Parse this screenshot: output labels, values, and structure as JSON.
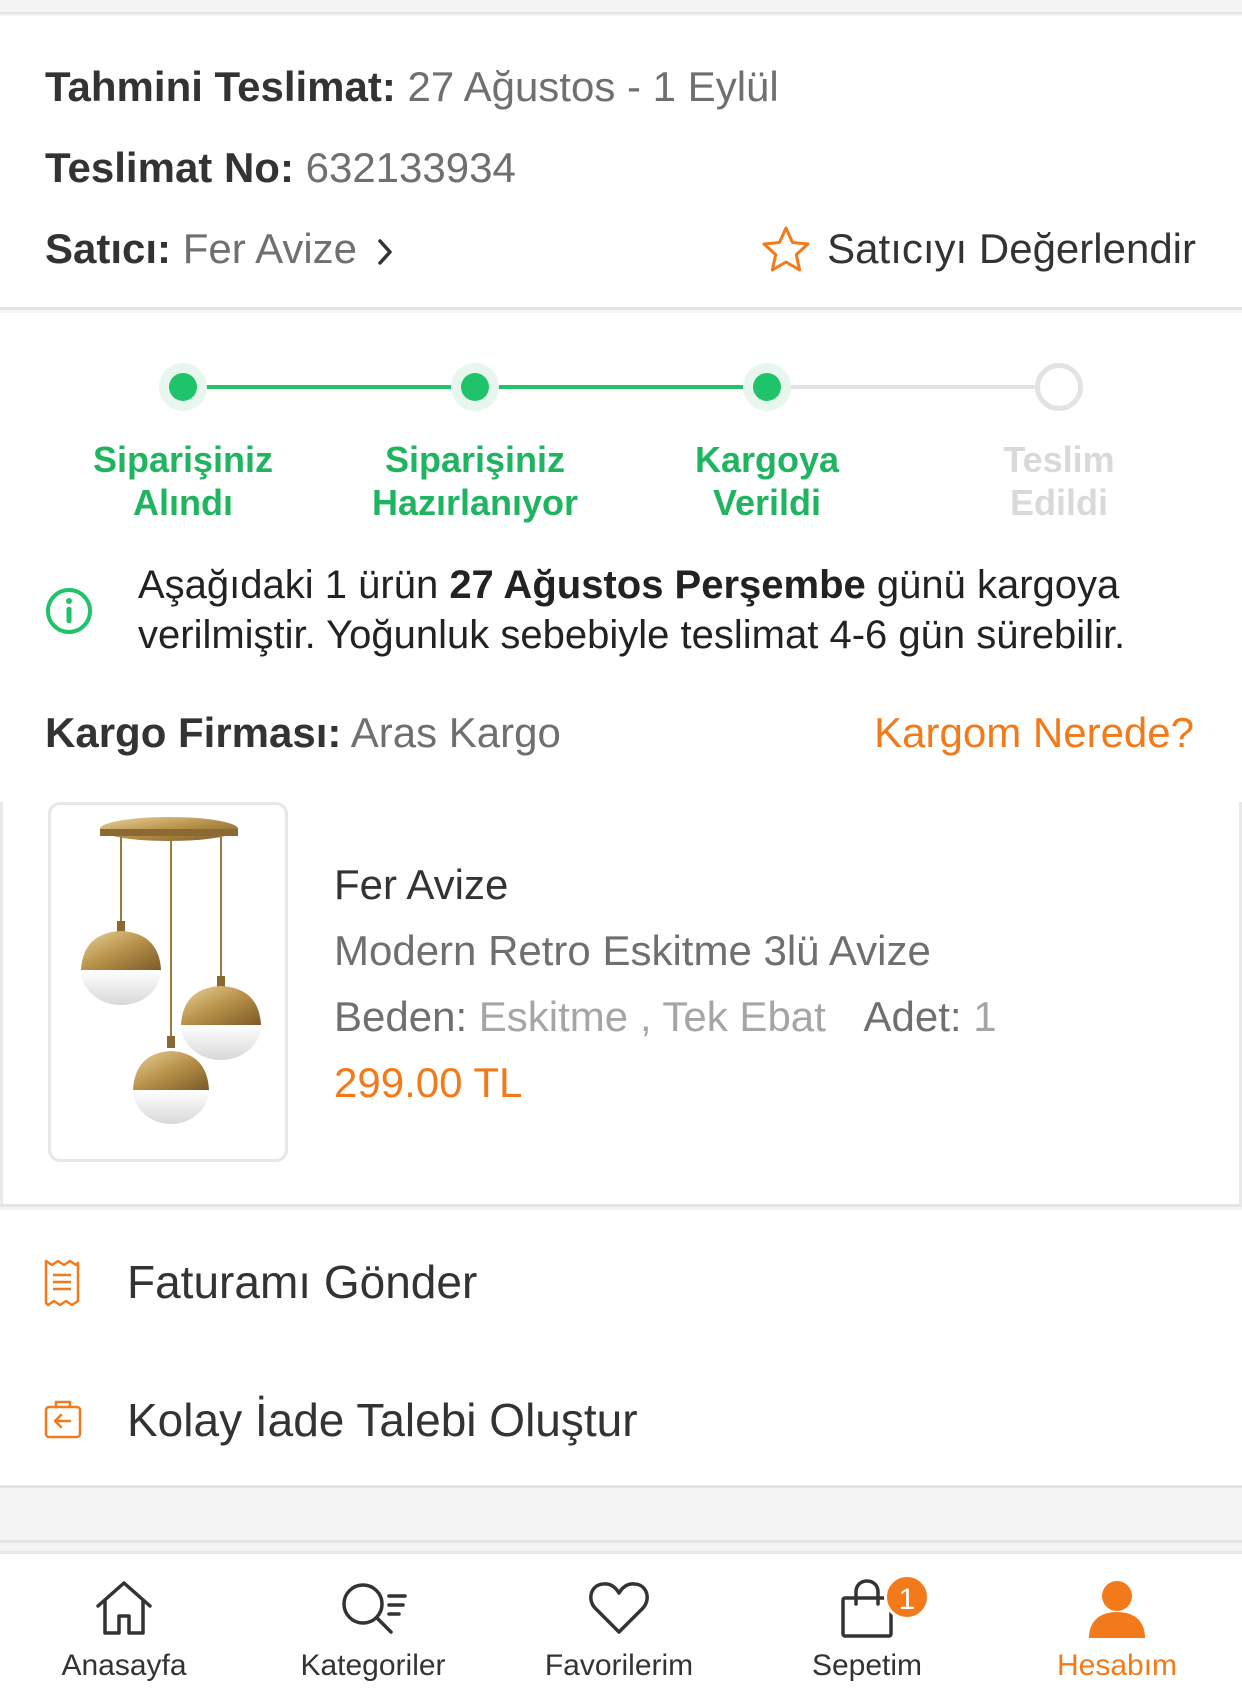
{
  "delivery": {
    "estimate_label": "Tahmini Teslimat:",
    "estimate_value": "27 Ağustos - 1 Eylül",
    "number_label": "Teslimat No:",
    "number_value": "632133934",
    "seller_label": "Satıcı:",
    "seller_value": "Fer Avize",
    "rate_seller": "Satıcıyı Değerlendir"
  },
  "tracking": {
    "steps": [
      {
        "line1": "Siparişiniz",
        "line2": "Alındı",
        "done": true
      },
      {
        "line1": "Siparişiniz",
        "line2": "Hazırlanıyor",
        "done": true
      },
      {
        "line1": "Kargoya",
        "line2": "Verildi",
        "done": true
      },
      {
        "line1": "Teslim",
        "line2": "Edildi",
        "done": false
      }
    ],
    "notice_pre": "Aşağıdaki 1 ürün ",
    "notice_bold": "27 Ağustos Perşembe",
    "notice_post": " günü kargoya verilmiştir. Yoğunluk sebebiyle teslimat 4-6 gün sürebilir.",
    "cargo_label": "Kargo Firması:",
    "cargo_value": "Aras Kargo",
    "where_link": "Kargom Nerede?"
  },
  "product": {
    "brand": "Fer Avize",
    "name": "Modern Retro Eskitme 3lü Avize",
    "size_label": "Beden:",
    "size_value": "Eskitme , Tek Ebat",
    "qty_label": "Adet:",
    "qty_value": "1",
    "price": "299.00 TL"
  },
  "actions": {
    "invoice": "Faturamı Gönder",
    "return": "Kolay İade Talebi Oluştur"
  },
  "nav": {
    "home": "Anasayfa",
    "categories": "Kategoriler",
    "favorites": "Favorilerim",
    "cart": "Sepetim",
    "cart_badge": "1",
    "account": "Hesabım"
  },
  "colors": {
    "accent": "#f27a1a",
    "success": "#1ec36a",
    "inactive": "#e3e3e3"
  }
}
